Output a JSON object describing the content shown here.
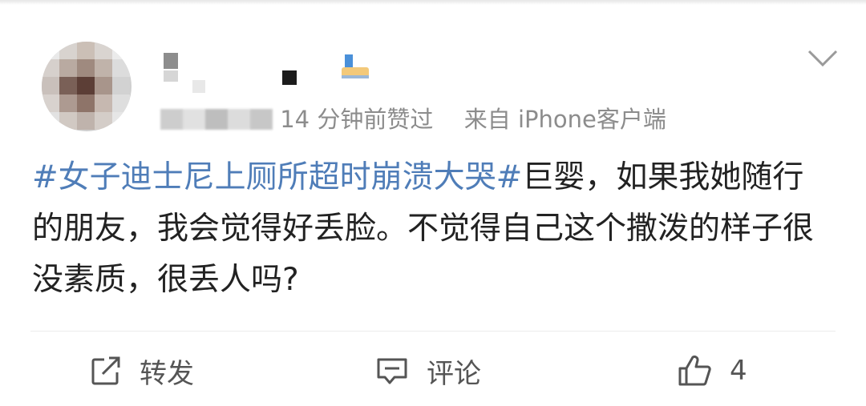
{
  "post": {
    "meta": "14 分钟前赞过",
    "source": "来自 iPhone客户端",
    "hashtag": "#女子迪士尼上厕所超时崩溃大哭#",
    "body": "巨婴，如果我她随行的朋友，我会觉得好丢脸。不觉得自己这个撒泼的样子很没素质，很丢人吗?"
  },
  "actions": {
    "repost_label": "转发",
    "comment_label": "评论",
    "like_count": "4"
  },
  "icons": {
    "repost": "repost-icon",
    "comment": "comment-icon",
    "like": "thumbs-up-icon",
    "more": "chevron-down-icon",
    "verified": "badge-icon"
  },
  "colors": {
    "hashtag": "#4f7db8",
    "text": "#222222",
    "meta": "#8c8c8c",
    "icon": "#555555"
  }
}
